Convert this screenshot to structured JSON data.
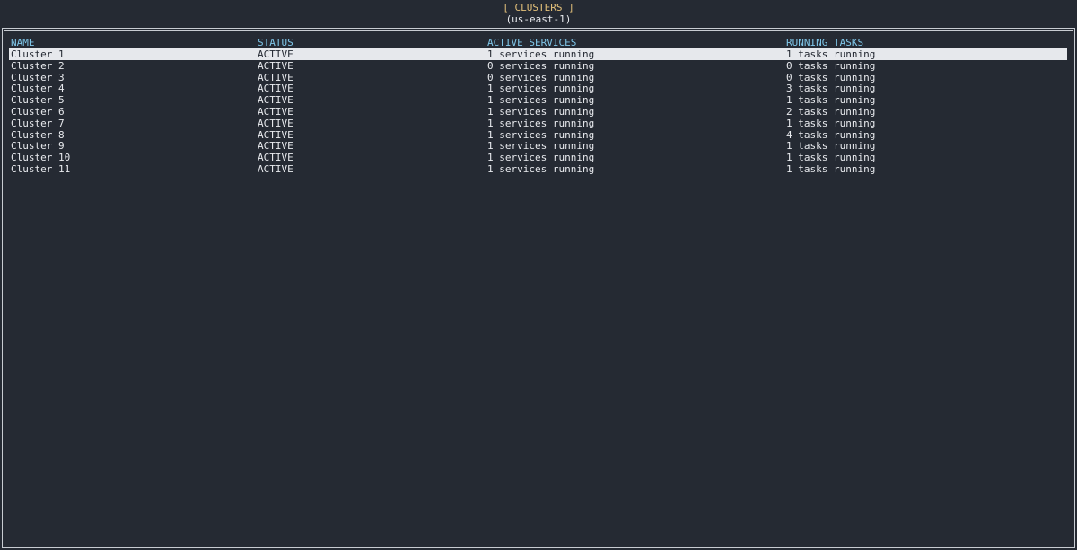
{
  "window": {
    "title": "[ CLUSTERS ]",
    "region": "(us-east-1)"
  },
  "table": {
    "columns": [
      "NAME",
      "STATUS",
      "ACTIVE SERVICES",
      "RUNNING TASKS"
    ],
    "selected_index": 0,
    "rows": [
      {
        "name": "Cluster 1",
        "status": "ACTIVE",
        "services": "1 services running",
        "tasks": "1 tasks running"
      },
      {
        "name": "Cluster 2",
        "status": "ACTIVE",
        "services": "0 services running",
        "tasks": "0 tasks running"
      },
      {
        "name": "Cluster 3",
        "status": "ACTIVE",
        "services": "0 services running",
        "tasks": "0 tasks running"
      },
      {
        "name": "Cluster 4",
        "status": "ACTIVE",
        "services": "1 services running",
        "tasks": "3 tasks running"
      },
      {
        "name": "Cluster 5",
        "status": "ACTIVE",
        "services": "1 services running",
        "tasks": "1 tasks running"
      },
      {
        "name": "Cluster 6",
        "status": "ACTIVE",
        "services": "1 services running",
        "tasks": "2 tasks running"
      },
      {
        "name": "Cluster 7",
        "status": "ACTIVE",
        "services": "1 services running",
        "tasks": "1 tasks running"
      },
      {
        "name": "Cluster 8",
        "status": "ACTIVE",
        "services": "1 services running",
        "tasks": "4 tasks running"
      },
      {
        "name": "Cluster 9",
        "status": "ACTIVE",
        "services": "1 services running",
        "tasks": "1 tasks running"
      },
      {
        "name": "Cluster 10",
        "status": "ACTIVE",
        "services": "1 services running",
        "tasks": "1 tasks running"
      },
      {
        "name": "Cluster 11",
        "status": "ACTIVE",
        "services": "1 services running",
        "tasks": "1 tasks running"
      }
    ]
  },
  "colors": {
    "background": "#252a33",
    "header_text": "#7fc6e8",
    "title_text": "#e3c07a",
    "selection_bg": "#e6e8ec"
  }
}
